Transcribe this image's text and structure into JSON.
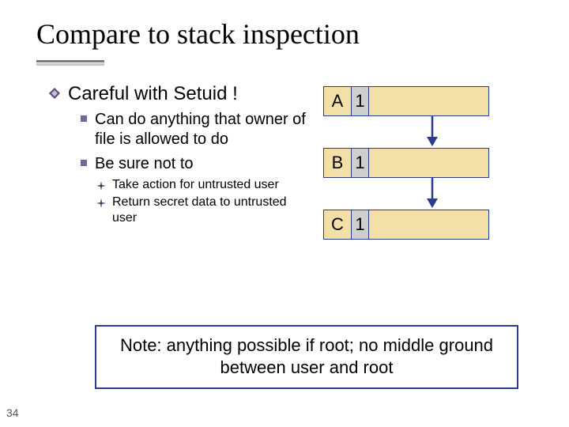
{
  "title": "Compare to stack inspection",
  "heading": "Careful with Setuid !",
  "sub": {
    "a": "Can do anything that owner of file is allowed to do",
    "b": "Be sure not to"
  },
  "subsub": {
    "a": "Take action for untrusted user",
    "b": "Return secret data to untrusted user"
  },
  "rows": [
    {
      "label": "A",
      "value": "1"
    },
    {
      "label": "B",
      "value": "1"
    },
    {
      "label": "C",
      "value": "1"
    }
  ],
  "note": "Note: anything possible if root; no middle ground between user and root",
  "page": "34"
}
